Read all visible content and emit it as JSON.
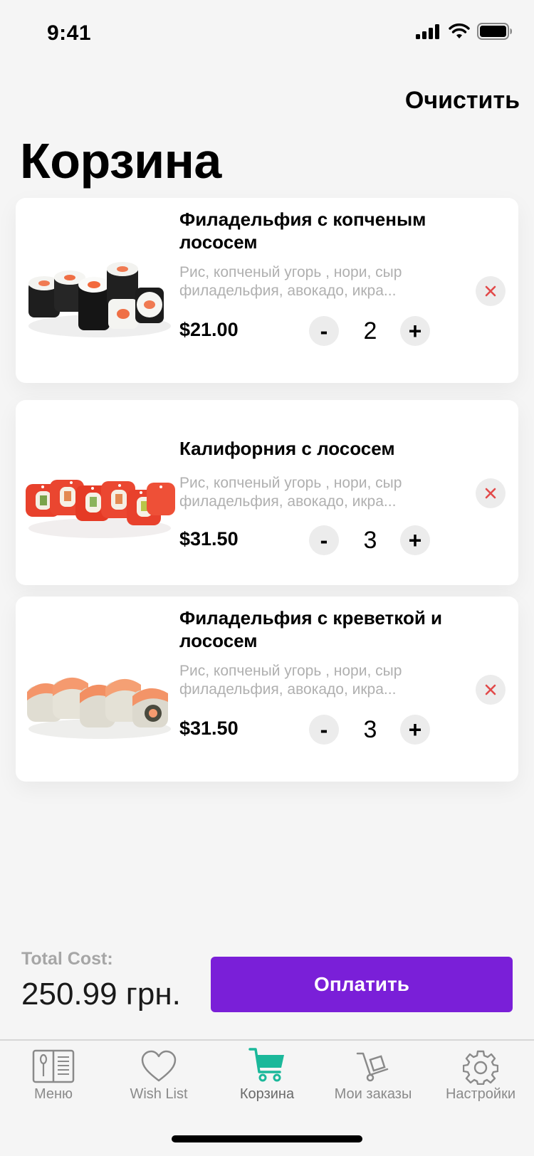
{
  "status_bar": {
    "time": "9:41"
  },
  "header": {
    "clear_label": "Очистить",
    "title": "Корзина"
  },
  "cart_items": [
    {
      "name": "Филадельфия с копченым лососем",
      "description": "Рис, копченый угорь , нори, сыр филадельфия, авокадо, икра...",
      "price": "$21.00",
      "quantity": "2",
      "minus": "-",
      "plus": "+",
      "image": "sushi-rolls-nori-salmon"
    },
    {
      "name": "Калифорния с лососем",
      "description": "Рис, копченый угорь , нори, сыр филадельфия, авокадо, икра...",
      "price": "$31.50",
      "quantity": "3",
      "minus": "-",
      "plus": "+",
      "image": "sushi-rolls-red-caviar"
    },
    {
      "name": "Филадельфия с креветкой и лососем",
      "description": "Рис, копченый угорь , нори, сыр филадельфия, авокадо, икра...",
      "price": "$31.50",
      "quantity": "3",
      "minus": "-",
      "plus": "+",
      "image": "sushi-rolls-salmon-topped"
    }
  ],
  "footer": {
    "total_label": "Total Cost:",
    "total_value": "250.99 грн.",
    "pay_label": "Оплатить"
  },
  "tabs": [
    {
      "label": "Меню",
      "icon": "menu-book-icon",
      "active": false
    },
    {
      "label": "Wish List",
      "icon": "heart-icon",
      "active": false
    },
    {
      "label": "Корзина",
      "icon": "cart-icon",
      "active": true
    },
    {
      "label": "Мои заказы",
      "icon": "hand-truck-icon",
      "active": false
    },
    {
      "label": "Настройки",
      "icon": "gear-icon",
      "active": false
    }
  ],
  "colors": {
    "accent": "#7a1fd8",
    "active_tab": "#1bb89a",
    "remove": "#e24a4a",
    "muted_text": "#b0b0b0"
  }
}
